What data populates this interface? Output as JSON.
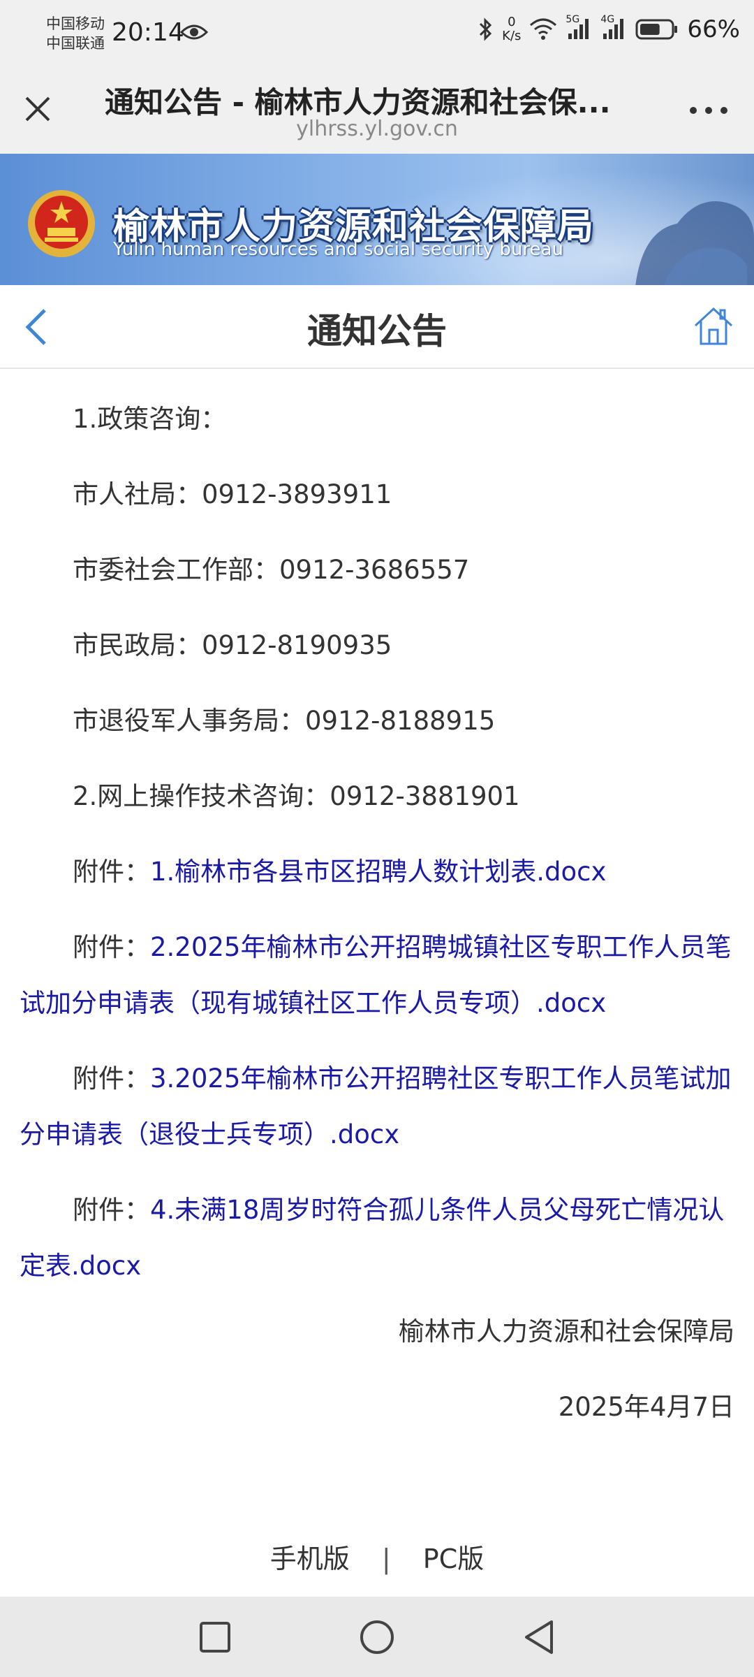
{
  "status_bar": {
    "carrier1": "中国移动",
    "carrier2": "中国联通",
    "time": "20:14",
    "net_speed_value": "0",
    "net_speed_unit": "K/s",
    "signal1_label": "5G",
    "signal2_label": "4G",
    "battery": "66%",
    "battery_level": 0.66
  },
  "browser": {
    "title": "通知公告 - 榆林市人力资源和社会保...",
    "domain": "ylhrss.yl.gov.cn"
  },
  "banner": {
    "title": "榆林市人力资源和社会保障局",
    "subtitle": "Yulin human resources and social security bureau"
  },
  "nav": {
    "title": "通知公告"
  },
  "content": {
    "lines": [
      "1.政策咨询：",
      "市人社局：0912-3893911",
      "市委社会工作部：0912-3686557",
      "市民政局：0912-8190935",
      "市退役军人事务局：0912-8188915",
      "2.网上操作技术咨询：0912-3881901"
    ],
    "attachments": [
      {
        "prefix": "附件：",
        "link": "1.榆林市各县市区招聘人数计划表.docx"
      },
      {
        "prefix": "附件：",
        "link": "2.2025年榆林市公开招聘城镇社区专职工作人员笔试加分申请表（现有城镇社区工作人员专项）.docx"
      },
      {
        "prefix": "附件：",
        "link": "3.2025年榆林市公开招聘社区专职工作人员笔试加分申请表（退役士兵专项）.docx"
      },
      {
        "prefix": "附件：",
        "link": "4.未满18周岁时符合孤儿条件人员父母死亡情况认定表.docx"
      }
    ],
    "signature": "榆林市人力资源和社会保障局",
    "date": "2025年4月7日"
  },
  "footer": {
    "mobile": "手机版",
    "separator": "|",
    "pc": "PC版"
  },
  "colors": {
    "link": "#1a1aa6",
    "nav_icon": "#3f86d6",
    "banner": "#6b9be0"
  },
  "icons": [
    "eye-icon",
    "bluetooth-icon",
    "wifi-icon",
    "signal-icon",
    "battery-icon",
    "close-icon",
    "more-icon",
    "national-emblem-icon",
    "back-arrow-icon",
    "home-icon",
    "recent-apps-icon",
    "home-circle-icon",
    "back-triangle-icon"
  ]
}
